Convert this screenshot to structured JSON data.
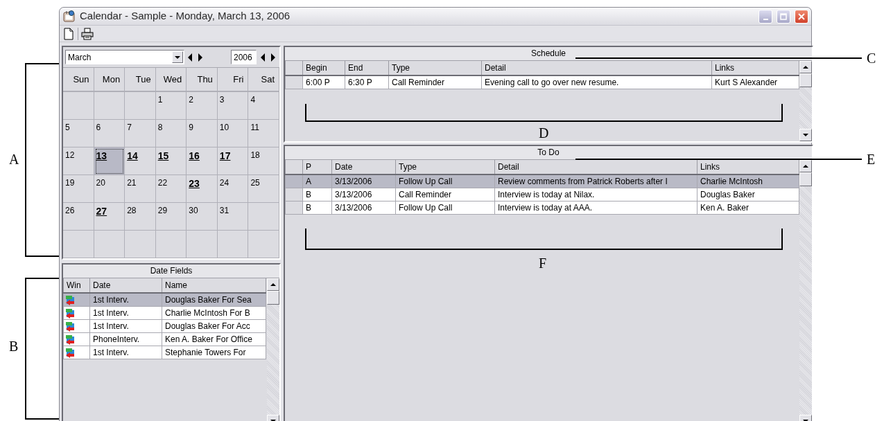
{
  "window": {
    "title": "Calendar - Sample - Monday, March 13, 2006"
  },
  "calendar": {
    "month": "March",
    "year": "2006",
    "weekdays": [
      "Sun",
      "Mon",
      "Tue",
      "Wed",
      "Thu",
      "Fri",
      "Sat"
    ],
    "weeks": [
      [
        {
          "day": "1",
          "bold": false,
          "selected": false
        },
        {
          "day": "2",
          "bold": false,
          "selected": false
        },
        {
          "day": "3",
          "bold": false,
          "selected": false
        },
        {
          "day": "4",
          "bold": false,
          "selected": false
        }
      ],
      [
        {
          "day": "5",
          "bold": false,
          "selected": false
        },
        {
          "day": "6",
          "bold": false,
          "selected": false
        },
        {
          "day": "7",
          "bold": false,
          "selected": false
        },
        {
          "day": "8",
          "bold": false,
          "selected": false
        },
        {
          "day": "9",
          "bold": false,
          "selected": false
        },
        {
          "day": "10",
          "bold": false,
          "selected": false
        },
        {
          "day": "11",
          "bold": false,
          "selected": false
        }
      ],
      [
        {
          "day": "12",
          "bold": false,
          "selected": false
        },
        {
          "day": "13",
          "bold": true,
          "selected": true
        },
        {
          "day": "14",
          "bold": true,
          "selected": false
        },
        {
          "day": "15",
          "bold": true,
          "selected": false
        },
        {
          "day": "16",
          "bold": true,
          "selected": false
        },
        {
          "day": "17",
          "bold": true,
          "selected": false
        },
        {
          "day": "18",
          "bold": false,
          "selected": false
        }
      ],
      [
        {
          "day": "19",
          "bold": false,
          "selected": false
        },
        {
          "day": "20",
          "bold": false,
          "selected": false
        },
        {
          "day": "21",
          "bold": false,
          "selected": false
        },
        {
          "day": "22",
          "bold": false,
          "selected": false
        },
        {
          "day": "23",
          "bold": true,
          "selected": false
        },
        {
          "day": "24",
          "bold": false,
          "selected": false
        },
        {
          "day": "25",
          "bold": false,
          "selected": false
        }
      ],
      [
        {
          "day": "26",
          "bold": false,
          "selected": false
        },
        {
          "day": "27",
          "bold": true,
          "selected": false
        },
        {
          "day": "28",
          "bold": false,
          "selected": false
        },
        {
          "day": "29",
          "bold": false,
          "selected": false
        },
        {
          "day": "30",
          "bold": false,
          "selected": false
        },
        {
          "day": "31",
          "bold": false,
          "selected": false
        }
      ]
    ]
  },
  "date_fields": {
    "title": "Date Fields",
    "columns": [
      "Win",
      "Date",
      "Name"
    ],
    "rows": [
      {
        "date": "1st Interv.",
        "name": "Douglas  Baker For Sea",
        "selected": true
      },
      {
        "date": "1st Interv.",
        "name": "Charlie  McIntosh For B",
        "selected": false
      },
      {
        "date": "1st Interv.",
        "name": "Douglas  Baker For Acc",
        "selected": false
      },
      {
        "date": "PhoneInterv.",
        "name": "Ken A. Baker For Office",
        "selected": false
      },
      {
        "date": "1st Interv.",
        "name": "Stephanie  Towers For",
        "selected": false
      }
    ]
  },
  "schedule": {
    "title": "Schedule",
    "columns": [
      "Begin",
      "End",
      "Type",
      "Detail",
      "Links"
    ],
    "rows": [
      {
        "cells": [
          "6:00 P",
          "6:30 P",
          "Call Reminder",
          "Evening call to go over new resume.",
          "Kurt S Alexander"
        ],
        "selected": false
      }
    ]
  },
  "todo": {
    "title": "To Do",
    "columns": [
      "P",
      "Date",
      "Type",
      "Detail",
      "Links"
    ],
    "rows": [
      {
        "cells": [
          "A",
          "3/13/2006",
          "Follow Up Call",
          "Review comments from Patrick Roberts after I",
          "Charlie  McIntosh"
        ],
        "selected": true
      },
      {
        "cells": [
          "B",
          "3/13/2006",
          "Call Reminder",
          "Interview is today at Nilax.",
          "Douglas  Baker"
        ],
        "selected": false
      },
      {
        "cells": [
          "B",
          "3/13/2006",
          "Follow Up Call",
          "Interview is today at AAA.",
          "Ken A. Baker"
        ],
        "selected": false
      }
    ]
  },
  "callouts": [
    {
      "letter": "A"
    },
    {
      "letter": "B"
    },
    {
      "letter": "C"
    },
    {
      "letter": "D"
    },
    {
      "letter": "E"
    },
    {
      "letter": "F"
    }
  ]
}
